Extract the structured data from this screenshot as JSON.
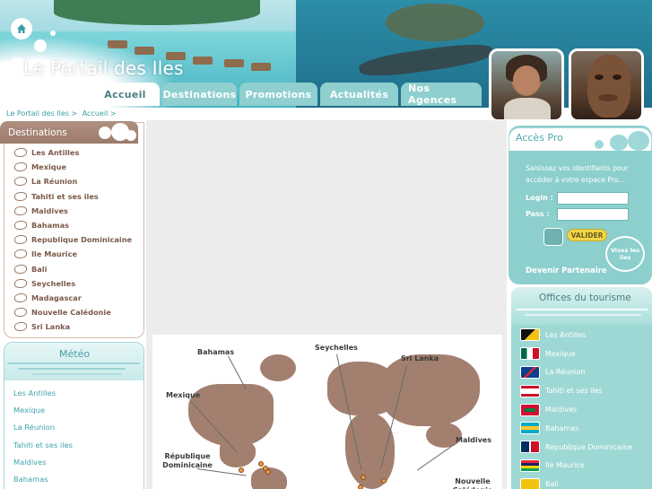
{
  "site": {
    "title": "Le Portail des Iles"
  },
  "nav": {
    "tabs": [
      {
        "label": "Accueil"
      },
      {
        "label": "Destinations"
      },
      {
        "label": "Promotions"
      },
      {
        "label": "Actualités"
      },
      {
        "label": "Nos Agences"
      }
    ],
    "active_tab": "Accueil"
  },
  "breadcrumb": {
    "items": [
      "Le Portail des Iles >",
      "Accueil >"
    ]
  },
  "destinations": {
    "title": "Destinations",
    "items": [
      "Les Antilles",
      "Mexique",
      "La Réunion",
      "Tahiti et ses iles",
      "Maldives",
      "Bahamas",
      "Republique Dominicaine",
      "Ile Maurice",
      "Bali",
      "Seychelles",
      "Madagascar",
      "Nouvelle Calédonie",
      "Sri Lanka"
    ]
  },
  "meteo": {
    "title": "Météo",
    "items": [
      "Les Antilles",
      "Mexique",
      "La Réunion",
      "Tahiti et ses iles",
      "Maldives",
      "Bahamas"
    ]
  },
  "map": {
    "labels": [
      "Bahamas",
      "Seychelles",
      "Sri Lanka",
      "Mexique",
      "Maldives",
      "République Dominicaine",
      "Nouvelle Calédonie"
    ],
    "land_color": "#a27f6f",
    "pin_color": "#e59a45"
  },
  "pro": {
    "title": "Accès Pro",
    "intro": "Saisissez vos identifiants pour accéder à votre espace Pro...",
    "login_label": "Login :",
    "login_value": "",
    "password_label": "Pass :",
    "password_value": "",
    "submit_label": "VALIDER",
    "partner_link": "Devenir Partenaire",
    "badge_text": "Vivez les iles"
  },
  "offices": {
    "title": "Offices du tourisme",
    "items": [
      {
        "label": "Les Antilles",
        "flag": "antilles-flag-icon"
      },
      {
        "label": "Mexique",
        "flag": "mexico-flag-icon"
      },
      {
        "label": "La Réunion",
        "flag": "reunion-flag-icon"
      },
      {
        "label": "Tahiti et ses iles",
        "flag": "tahiti-flag-icon"
      },
      {
        "label": "Maldives",
        "flag": "maldives-flag-icon"
      },
      {
        "label": "Bahamas",
        "flag": "bahamas-flag-icon"
      },
      {
        "label": "Republique Dominicaine",
        "flag": "dominican-republic-flag-icon"
      },
      {
        "label": "Ile Maurice",
        "flag": "mauritius-flag-icon"
      },
      {
        "label": "Bali",
        "flag": "bali-flag-icon"
      }
    ]
  },
  "colors": {
    "accent_teal": "#4da8ae",
    "brown": "#9c7b6b",
    "tab_inactive": "#8fcfcf"
  }
}
